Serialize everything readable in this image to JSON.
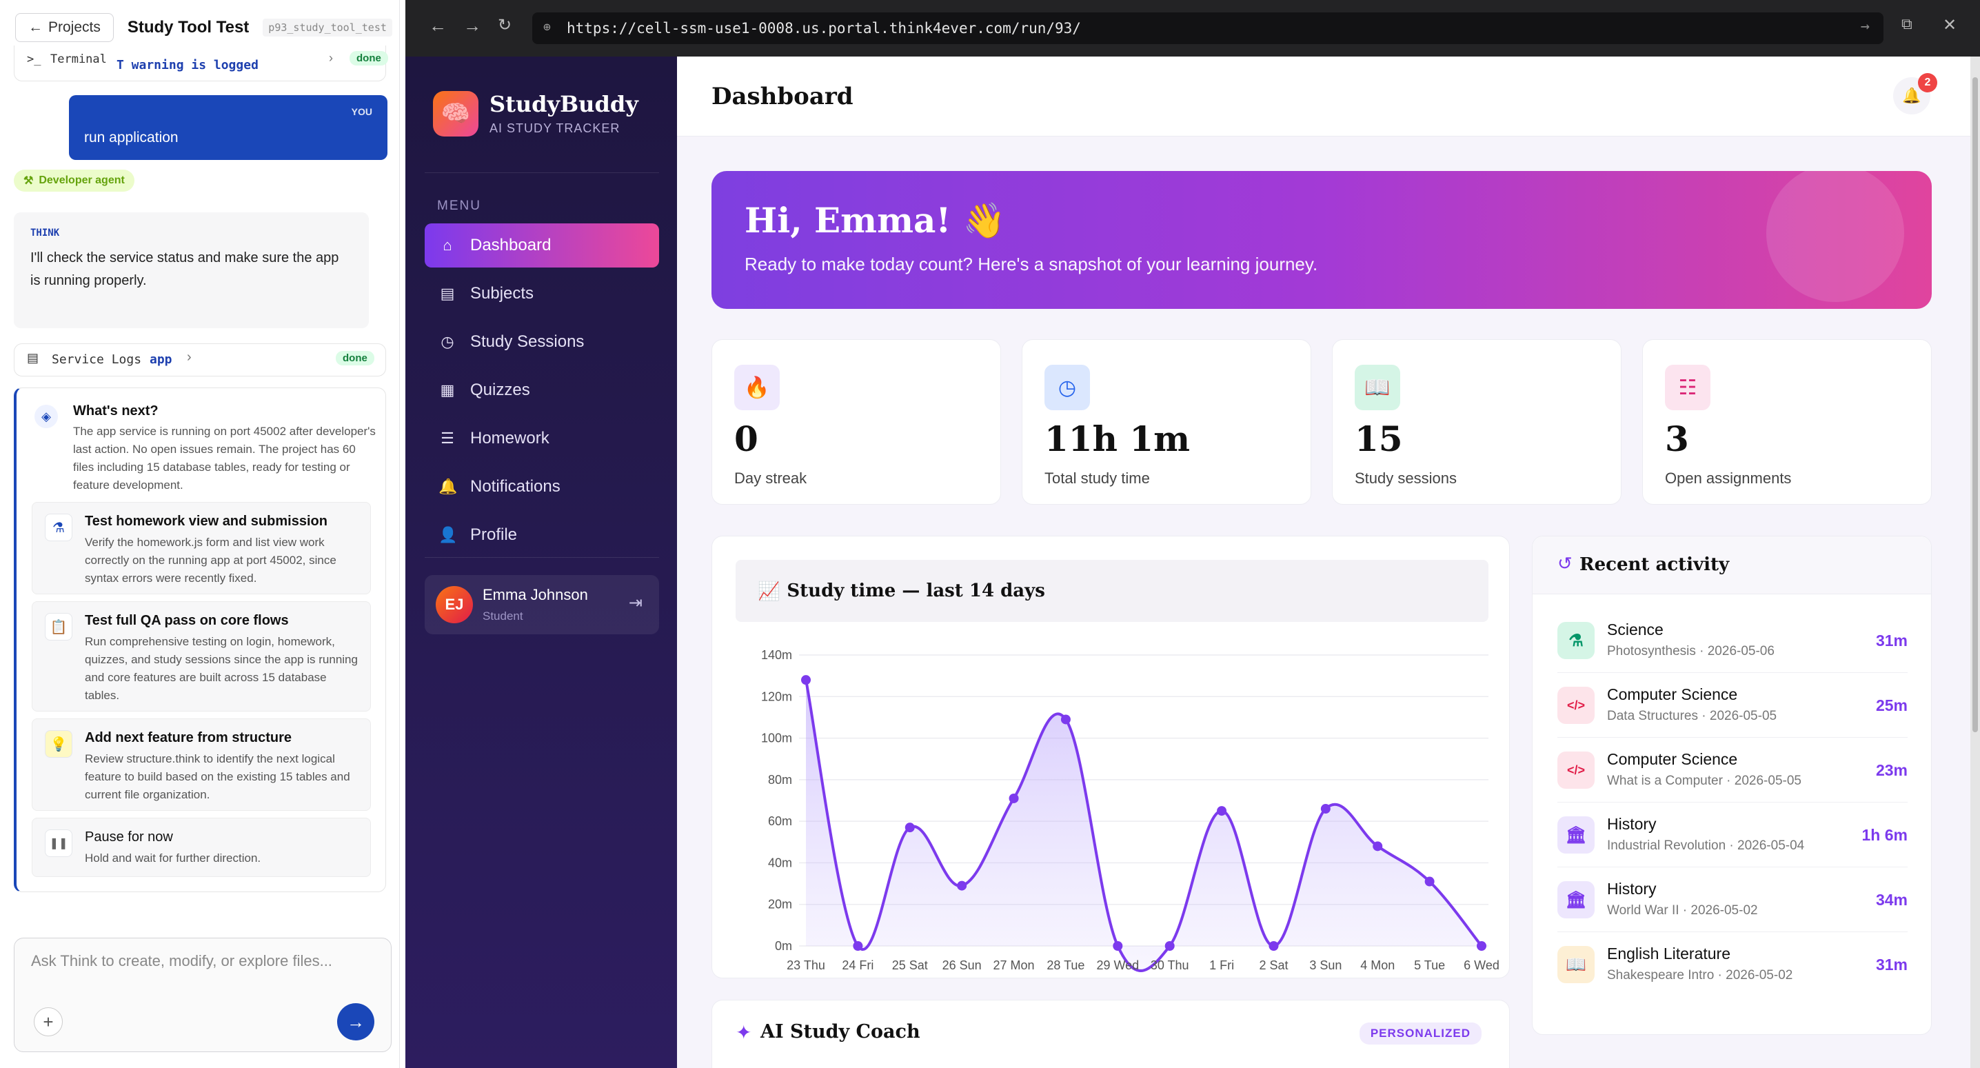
{
  "left": {
    "projects_label": "Projects",
    "project_title": "Study Tool Test",
    "project_slug": "p93_study_tool_test",
    "terminal_label": "Terminal",
    "terminal_text": "T warning is logged",
    "terminal_status": "done",
    "you_tag": "YOU",
    "you_message": "run application",
    "agent_badge": "Developer agent",
    "think_tag": "THINK",
    "think_text": "I'll check the service status and make sure the app is running properly.",
    "logs_label": "Service Logs",
    "logs_app": "app",
    "logs_status": "done",
    "next_title": "What's next?",
    "next_desc": "The app service is running on port 45002 after developer's last action. No open issues remain. The project has 60 files including 15 database tables, ready for testing or feature development.",
    "next_items": [
      {
        "title": "Test homework view and submission",
        "desc": "Verify the homework.js form and list view work correctly on the running app at port 45002, since syntax errors were recently fixed.",
        "icon": "flask-icon"
      },
      {
        "title": "Test full QA pass on core flows",
        "desc": "Run comprehensive testing on login, homework, quizzes, and study sessions since the app is running and core features are built across 15 database tables.",
        "icon": "clipboard-icon"
      },
      {
        "title": "Add next feature from structure",
        "desc": "Review structure.think to identify the next logical feature to build based on the existing 15 tables and current file organization.",
        "icon": "lightbulb-icon"
      },
      {
        "title": "Pause for now",
        "desc": "Hold and wait for further direction.",
        "icon": "pause-icon"
      }
    ],
    "chat_placeholder": "Ask Think to create, modify, or explore files..."
  },
  "browser": {
    "url": "https://cell-ssm-use1-0008.us.portal.think4ever.com/run/93/"
  },
  "app": {
    "brand": "StudyBuddy",
    "brand_sub": "AI STUDY TRACKER",
    "menu_label": "MENU",
    "nav": [
      {
        "label": "Dashboard",
        "icon": "home-icon"
      },
      {
        "label": "Subjects",
        "icon": "book-icon"
      },
      {
        "label": "Study Sessions",
        "icon": "clock-icon"
      },
      {
        "label": "Quizzes",
        "icon": "clipboard-icon"
      },
      {
        "label": "Homework",
        "icon": "list-icon"
      },
      {
        "label": "Notifications",
        "icon": "bell-icon"
      },
      {
        "label": "Profile",
        "icon": "user-icon"
      }
    ],
    "user_initials": "EJ",
    "user_name": "Emma Johnson",
    "user_role": "Student",
    "page_title": "Dashboard",
    "notif_count": "2",
    "hero_title": "Hi, Emma! 👋",
    "hero_sub": "Ready to make today count? Here's a snapshot of your learning journey.",
    "stats": [
      {
        "value": "0",
        "label": "Day streak",
        "icon": "flame-icon",
        "color": "#7c3aed",
        "bg": "#efe9fd"
      },
      {
        "value": "11h 1m",
        "label": "Total study time",
        "icon": "clock-icon",
        "color": "#2563eb",
        "bg": "#dbe7fe"
      },
      {
        "value": "15",
        "label": "Study sessions",
        "icon": "book-open-icon",
        "color": "#059669",
        "bg": "#d5f5e6"
      },
      {
        "value": "3",
        "label": "Open assignments",
        "icon": "checklist-icon",
        "color": "#db2777",
        "bg": "#fce4ef"
      }
    ],
    "chart_title": "Study time — last 14 days",
    "activity_title": "Recent activity",
    "activity": [
      {
        "subject": "Science",
        "detail": "Photosynthesis · 2026-05-06",
        "time": "31m",
        "icon": "flask-icon",
        "color": "#059669",
        "bg": "#d5f5e6"
      },
      {
        "subject": "Computer Science",
        "detail": "Data Structures · 2026-05-05",
        "time": "25m",
        "icon": "code-icon",
        "color": "#e11d48",
        "bg": "#fde4ea"
      },
      {
        "subject": "Computer Science",
        "detail": "What is a Computer · 2026-05-05",
        "time": "23m",
        "icon": "code-icon",
        "color": "#e11d48",
        "bg": "#fde4ea"
      },
      {
        "subject": "History",
        "detail": "Industrial Revolution · 2026-05-04",
        "time": "1h 6m",
        "icon": "landmark-icon",
        "color": "#7c3aed",
        "bg": "#ede6fd"
      },
      {
        "subject": "History",
        "detail": "World War II · 2026-05-02",
        "time": "34m",
        "icon": "landmark-icon",
        "color": "#7c3aed",
        "bg": "#ede6fd"
      },
      {
        "subject": "English Literature",
        "detail": "Shakespeare Intro · 2026-05-02",
        "time": "31m",
        "icon": "book-open-icon",
        "color": "#d97706",
        "bg": "#fdefd4"
      }
    ],
    "coach_title": "AI Study Coach",
    "coach_badge": "PERSONALIZED"
  },
  "chart_data": {
    "type": "area",
    "title": "Study time — last 14 days",
    "categories": [
      "23 Thu",
      "24 Fri",
      "25 Sat",
      "26 Sun",
      "27 Mon",
      "28 Tue",
      "29 Wed",
      "30 Thu",
      "1 Fri",
      "2 Sat",
      "3 Sun",
      "4 Mon",
      "5 Tue",
      "6 Wed"
    ],
    "values": [
      128,
      0,
      57,
      29,
      71,
      109,
      0,
      0,
      65,
      0,
      66,
      48,
      31,
      0
    ],
    "y_ticks": [
      "0m",
      "20m",
      "40m",
      "60m",
      "80m",
      "100m",
      "120m",
      "140m"
    ],
    "ylim": [
      0,
      140
    ],
    "color": "#7c3aed",
    "grid": true
  }
}
